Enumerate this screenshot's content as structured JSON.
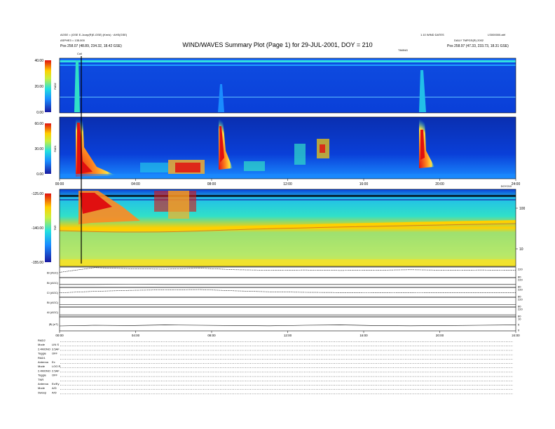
{
  "header": {
    "title": "WIND/WAVES Summary Plot (Page 1) for 29-JUL-2001, DOY = 210",
    "left_line1": "AGSE = (GSE E-Jcorp(R)E-GSE) (Km/s) · AHS(GSE)",
    "left_line2": "ASPHE3 = 135.000",
    "left_pos": "Pos    258.07 (48.89, 234.32, 18.42 GSE)",
    "right_line1": "1.10 WIND DATES",
    "right_line2": "LS000000.abf",
    "right_line3": "DAILY TMPGS(R) 2002",
    "right_pos": "Pos    258.97 (47.33, 233.73, 18.31 GSE)",
    "timing_label": "TIMING",
    "event_marker": "Coll"
  },
  "colors": {
    "background": "#ffffff",
    "spectrogram_base": "#0a3fd8",
    "tnr_base": "#b6e86a",
    "burst_red": "#e01010",
    "axis": "#000000"
  },
  "chart_data": [
    {
      "type": "heatmap",
      "name": "RAD2",
      "ylabel": "RAD2",
      "yticks": [
        "40.00",
        "20.00",
        "0.00"
      ],
      "xlim": [
        0,
        24
      ]
    },
    {
      "type": "heatmap",
      "name": "RAD1",
      "ylabel": "RAD1",
      "yticks": [
        "60.00",
        "30.00",
        "0.00"
      ],
      "xticks": [
        "00:00",
        "04:00",
        "08:00",
        "12:00",
        "16:00",
        "20:00",
        "24:00"
      ],
      "x": [
        0,
        4,
        8,
        12,
        16,
        20,
        24
      ],
      "xlim": [
        0,
        24
      ],
      "x_right_label": "DOY210"
    },
    {
      "type": "heatmap",
      "name": "TNR",
      "ylabel": "TNR",
      "yticks": [
        "-125.00",
        "-140.00",
        "-155.00"
      ],
      "right_ticks": [
        "100",
        "10"
      ],
      "xlim": [
        0,
        24
      ]
    },
    {
      "type": "line",
      "name": "waveforms",
      "panels": [
        {
          "label": "Bl (AGC)",
          "right_ticks": [
            "220",
            "80"
          ],
          "values": [
            0.5,
            0.95,
            0.85,
            0.8,
            0.9,
            0.75,
            0.7,
            0.72,
            0.68,
            0.7,
            0.75,
            0.7,
            0.72,
            0.7
          ]
        },
        {
          "label": "Bl (AGC)",
          "right_ticks": [
            "220",
            "80"
          ],
          "values": [
            0.3,
            0.3,
            0.32,
            0.3,
            0.3,
            0.3,
            0.3,
            0.3,
            0.3,
            0.3,
            0.3,
            0.3,
            0.3,
            0.3
          ]
        },
        {
          "label": "Cl (AGC)",
          "right_ticks": [
            "220",
            "80"
          ],
          "values": [
            0.45,
            0.6,
            0.7,
            0.75,
            0.78,
            0.65,
            0.55,
            0.5,
            0.48,
            0.47,
            0.46,
            0.45,
            0.45,
            0.45
          ]
        },
        {
          "label": "Bl (AGC)",
          "right_ticks": [
            "220",
            "80"
          ],
          "values": [
            0.25,
            0.25,
            0.25,
            0.25,
            0.25,
            0.25,
            0.25,
            0.25,
            0.25,
            0.25,
            0.25,
            0.25,
            0.25,
            0.25
          ]
        },
        {
          "label": "Al (AGC)",
          "right_ticks": [
            "220",
            "80"
          ],
          "values": [
            0.2,
            0.2,
            0.2,
            0.2,
            0.2,
            0.2,
            0.2,
            0.2,
            0.2,
            0.2,
            0.2,
            0.2,
            0.2,
            0.2
          ]
        },
        {
          "label": "|B| (nT)",
          "right_ticks": [
            "10",
            "5",
            "0"
          ],
          "values": [
            0.35,
            0.4,
            0.38,
            0.42,
            0.4,
            0.38,
            0.36,
            0.4,
            0.42,
            0.38,
            0.36,
            0.38,
            0.4,
            0.42
          ]
        }
      ],
      "xticks": [
        "00:00",
        "04:00",
        "08:00",
        "12:00",
        "16:00",
        "20:00",
        "24:00"
      ],
      "x": [
        0,
        4,
        8,
        12,
        16,
        20,
        24
      ]
    }
  ],
  "footer": {
    "rows": [
      {
        "key": "RAD2",
        "val": ""
      },
      {
        "key": "Mode",
        "val": "LIN S"
      },
      {
        "key": "2.4MONO",
        "val": "3.5AF"
      },
      {
        "key": "Toggle",
        "val": "OFF"
      },
      {
        "key": "RAD1",
        "val": ""
      },
      {
        "key": "Antenna",
        "val": "Ex"
      },
      {
        "key": "Mode",
        "val": "LOG R"
      },
      {
        "key": "2.4MONO",
        "val": "2.5AF"
      },
      {
        "key": "Toggle",
        "val": "OFF"
      },
      {
        "key": "TNR",
        "val": ""
      },
      {
        "key": "Antenna",
        "val": "Ex/Ey"
      },
      {
        "key": "Mode",
        "val": "A/D"
      },
      {
        "key": "Sweep",
        "val": "A/D"
      }
    ]
  }
}
